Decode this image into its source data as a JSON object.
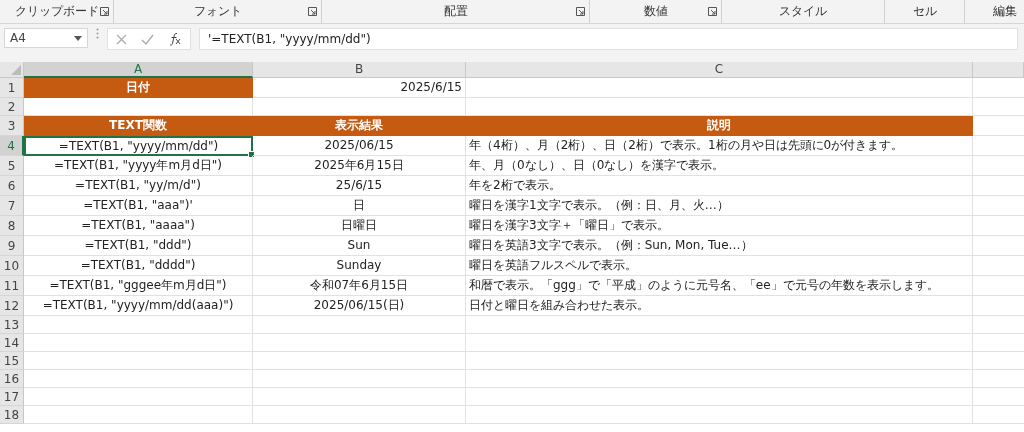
{
  "ribbon_groups": [
    {
      "label": "クリップボード",
      "launcher": true
    },
    {
      "label": "フォント",
      "launcher": true
    },
    {
      "label": "配置",
      "launcher": true
    },
    {
      "label": "数値",
      "launcher": true
    },
    {
      "label": "スタイル",
      "launcher": false
    },
    {
      "label": "セル",
      "launcher": false
    },
    {
      "label": "編集",
      "launcher": false
    }
  ],
  "formula_bar": {
    "name_box": "A4",
    "formula": "'=TEXT(B1, \"yyyy/mm/dd\")"
  },
  "columns": [
    {
      "label": "A",
      "selected": true
    },
    {
      "label": "B",
      "selected": false
    },
    {
      "label": "C",
      "selected": false
    }
  ],
  "rows": [
    {
      "number": "1",
      "selected": false,
      "cells": [
        {
          "text": "日付",
          "kind": "header",
          "active": false
        },
        {
          "text": "2025/6/15",
          "kind": "right",
          "active": false
        }
      ]
    },
    {
      "number": "2",
      "selected": false,
      "cells": []
    },
    {
      "number": "3",
      "selected": false,
      "cells": [
        {
          "text": "TEXT関数",
          "kind": "header",
          "active": false
        },
        {
          "text": "表示結果",
          "kind": "header",
          "active": false
        },
        {
          "text": "説明",
          "kind": "header",
          "active": false
        }
      ]
    },
    {
      "number": "4",
      "selected": true,
      "cells": [
        {
          "text": "=TEXT(B1, \"yyyy/mm/dd\")",
          "kind": "center",
          "active": true
        },
        {
          "text": "2025/06/15",
          "kind": "center",
          "active": false
        },
        {
          "text": "年（4桁）、月（2桁）、日（2桁）で表示。1桁の月や日は先頭に0が付きます。",
          "kind": "left",
          "active": false
        }
      ]
    },
    {
      "number": "5",
      "selected": false,
      "cells": [
        {
          "text": "=TEXT(B1, \"yyyy年m月d日\")",
          "kind": "center",
          "active": false
        },
        {
          "text": "2025年6月15日",
          "kind": "center",
          "active": false
        },
        {
          "text": "年、月（0なし）、日（0なし）を漢字で表示。",
          "kind": "left",
          "active": false
        }
      ]
    },
    {
      "number": "6",
      "selected": false,
      "cells": [
        {
          "text": "=TEXT(B1, \"yy/m/d\")",
          "kind": "center",
          "active": false
        },
        {
          "text": "25/6/15",
          "kind": "center",
          "active": false
        },
        {
          "text": "年を2桁で表示。",
          "kind": "left",
          "active": false
        }
      ]
    },
    {
      "number": "7",
      "selected": false,
      "cells": [
        {
          "text": "=TEXT(B1, \"aaa\")'",
          "kind": "center",
          "active": false
        },
        {
          "text": "日",
          "kind": "center",
          "active": false
        },
        {
          "text": "曜日を漢字1文字で表示。（例：日、月、火…）",
          "kind": "left",
          "active": false
        }
      ]
    },
    {
      "number": "8",
      "selected": false,
      "cells": [
        {
          "text": "=TEXT(B1, \"aaaa\")",
          "kind": "center",
          "active": false
        },
        {
          "text": "日曜日",
          "kind": "center",
          "active": false
        },
        {
          "text": "曜日を漢字3文字＋「曜日」で表示。",
          "kind": "left",
          "active": false
        }
      ]
    },
    {
      "number": "9",
      "selected": false,
      "cells": [
        {
          "text": "=TEXT(B1, \"ddd\")",
          "kind": "center",
          "active": false
        },
        {
          "text": "Sun",
          "kind": "center",
          "active": false
        },
        {
          "text": "曜日を英語3文字で表示。（例：Sun, Mon, Tue…）",
          "kind": "left",
          "active": false
        }
      ]
    },
    {
      "number": "10",
      "selected": false,
      "cells": [
        {
          "text": "=TEXT(B1, \"dddd\")",
          "kind": "center",
          "active": false
        },
        {
          "text": "Sunday",
          "kind": "center",
          "active": false
        },
        {
          "text": "曜日を英語フルスペルで表示。",
          "kind": "left",
          "active": false
        }
      ]
    },
    {
      "number": "11",
      "selected": false,
      "cells": [
        {
          "text": "=TEXT(B1, \"gggee年m月d日\")",
          "kind": "center",
          "active": false
        },
        {
          "text": "令和07年6月15日",
          "kind": "center",
          "active": false
        },
        {
          "text": "和暦で表示。「ggg」で「平成」のように元号名、「ee」で元号の年数を表示します。",
          "kind": "left",
          "active": false
        }
      ]
    },
    {
      "number": "12",
      "selected": false,
      "cells": [
        {
          "text": "=TEXT(B1, \"yyyy/mm/dd(aaa)\")",
          "kind": "center",
          "active": false
        },
        {
          "text": "2025/06/15(日)",
          "kind": "center",
          "active": false
        },
        {
          "text": "日付と曜日を組み合わせた表示。",
          "kind": "left",
          "active": false
        }
      ]
    },
    {
      "number": "13",
      "selected": false,
      "cells": []
    },
    {
      "number": "14",
      "selected": false,
      "cells": []
    },
    {
      "number": "15",
      "selected": false,
      "cells": []
    },
    {
      "number": "16",
      "selected": false,
      "cells": []
    },
    {
      "number": "17",
      "selected": false,
      "cells": []
    },
    {
      "number": "18",
      "selected": false,
      "cells": []
    }
  ]
}
